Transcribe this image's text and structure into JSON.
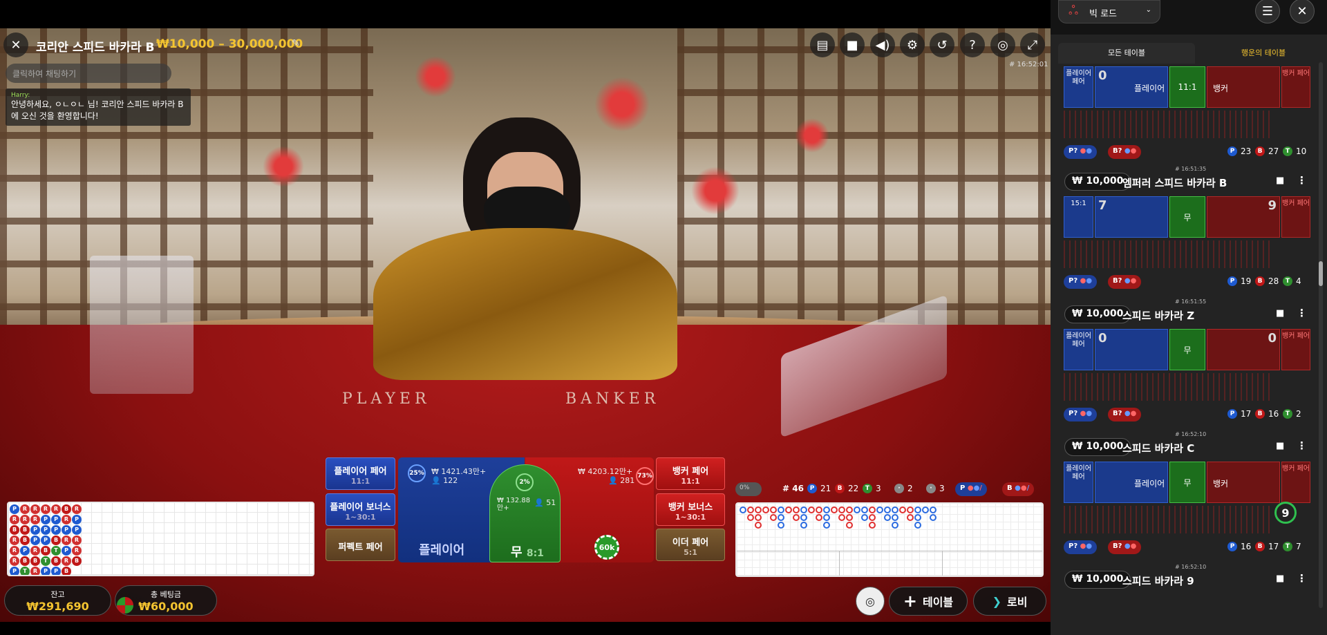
{
  "header": {
    "title": "코리안 스피드 바카라 B",
    "limits": "₩10,000 – 30,000,000",
    "clock": "# 16:52:01"
  },
  "chat": {
    "placeholder": "클릭하여 채팅하기",
    "user": "Harry:",
    "message": "안녕하세요, ㅇㄴㅇㄴ 님! 코리안 스피드 바카라 B에 오신 것을 환영합니다!"
  },
  "table_print": {
    "player": "PLAYER",
    "banker": "BANKER"
  },
  "bets": {
    "player_pair": {
      "label": "플레이어 페어",
      "odds": "11:1"
    },
    "player_bonus": {
      "label": "플레이어 보너스",
      "odds": "1~30:1"
    },
    "perfect_pair": {
      "label": "퍼펙트 페어"
    },
    "banker_pair": {
      "label": "뱅커 페어",
      "odds": "11:1"
    },
    "banker_bonus": {
      "label": "뱅커 보너스",
      "odds": "1~30:1"
    },
    "either_pair": {
      "label": "이더 페어",
      "odds": "5:1"
    },
    "player": {
      "label": "플레이어",
      "pct": "25%",
      "amount": "₩ 1421.43만+",
      "players": "122"
    },
    "tie": {
      "label": "무",
      "odds": "8:1",
      "pct": "2%",
      "amount": "₩ 132.88 만+",
      "players": "51"
    },
    "banker": {
      "pct": "73%",
      "amount": "₩ 4203.12만+",
      "players": "281",
      "chip": "60k"
    }
  },
  "road_stats": {
    "toggle": "0%",
    "rounds": "# 46",
    "player": "21",
    "banker": "22",
    "tie": "3",
    "bpair": "2",
    "ppair": "3",
    "p_pred": "P",
    "b_pred": "B"
  },
  "bead_road": [
    [
      "P",
      "R",
      "R",
      "R",
      "R",
      "B",
      "R"
    ],
    [
      "R",
      "R",
      "R",
      "P",
      "P",
      "R",
      "P"
    ],
    [
      "B",
      "B",
      "P",
      "P",
      "P",
      "P",
      "P"
    ],
    [
      "R",
      "B",
      "P",
      "P",
      "B",
      "R",
      "R"
    ],
    [
      "R",
      "P",
      "R",
      "B",
      "T",
      "P",
      "R"
    ],
    [
      "R",
      "B",
      "B",
      "T",
      "B",
      "R",
      "B"
    ],
    [
      "P",
      "T",
      "R",
      "P",
      "P",
      "B",
      ""
    ]
  ],
  "footer": {
    "balance_label": "잔고",
    "balance": "₩291,690",
    "total_bet_label": "총 베팅금",
    "total_bet": "₩60,000",
    "table_button": "테이블",
    "lobby_button": "로비"
  },
  "panel": {
    "road_select": "빅 로드",
    "tabs": [
      "모든 테이블",
      "행운의 테이블"
    ],
    "tables": [
      {
        "min": "",
        "name": "",
        "stamp": "",
        "player_pair": "플레이어 페어",
        "player_score": "0",
        "player_label": "플레이어",
        "tie": "11:1",
        "banker_label": "뱅커",
        "banker_pair": "뱅커 페어",
        "p_count": "23",
        "b_count": "27",
        "t_count": "10"
      },
      {
        "min": "₩ 10,000",
        "name": "엠퍼러 스피드 바카라 B",
        "stamp": "# 16:51:35",
        "player_pair": "15:1",
        "player_score": "7",
        "tie": "무",
        "banker_score": "9",
        "banker_pair": "뱅커 페어",
        "p_count": "19",
        "b_count": "28",
        "t_count": "4"
      },
      {
        "min": "₩ 10,000",
        "name": "스피드 바카라 Z",
        "stamp": "# 16:51:55",
        "player_pair": "플레이어 페어",
        "player_score": "0",
        "tie": "무",
        "banker_score": "0",
        "banker_pair": "뱅커 페어",
        "p_count": "17",
        "b_count": "16",
        "t_count": "2"
      },
      {
        "min": "₩ 10,000",
        "name": "스피드 바카라 C",
        "stamp": "# 16:52:10",
        "player_pair": "플레이어 페어",
        "player_label": "플레이어",
        "tie": "무",
        "banker_label": "뱅커",
        "banker_pair": "뱅커 페어",
        "timer": "9",
        "p_count": "16",
        "b_count": "17",
        "t_count": "7"
      },
      {
        "min": "₩ 10,000",
        "name": "스피드 바카라 9",
        "stamp": "# 16:52:10"
      }
    ],
    "pred_p": "P?",
    "pred_b": "B?"
  },
  "colors": {
    "player": "#1e3f9a",
    "banker": "#c01818",
    "tie": "#2f8f2f",
    "gold": "#f4c430"
  }
}
